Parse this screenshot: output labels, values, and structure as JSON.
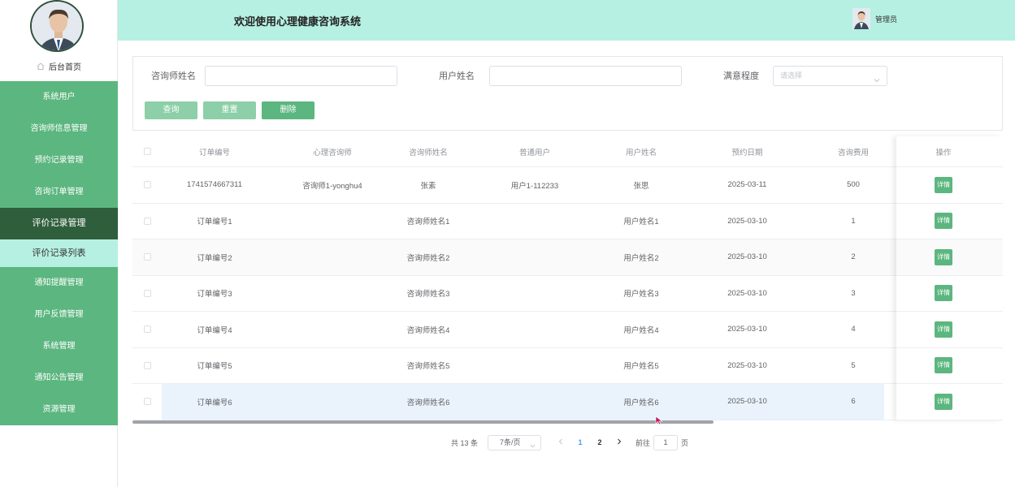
{
  "header": {
    "title": "欢迎使用心理健康咨询系统",
    "user": "管理员",
    "bg_color": "#b6f0e2"
  },
  "sidebar": {
    "home": "后台首页",
    "items": [
      {
        "label": "系统用户"
      },
      {
        "label": "咨询师信息管理"
      },
      {
        "label": "预约记录管理"
      },
      {
        "label": "咨询订单管理"
      },
      {
        "label": "评价记录管理"
      },
      {
        "label": "评价记录列表"
      },
      {
        "label": "通知提醒管理"
      },
      {
        "label": "用户反馈管理"
      },
      {
        "label": "系统管理"
      },
      {
        "label": "通知公告管理"
      },
      {
        "label": "资源管理"
      }
    ],
    "colors": {
      "item": "#5cb67f",
      "active": "#2e5e3b",
      "sub": "#b6f0e2"
    }
  },
  "search": {
    "consultant_label": "咨询师姓名",
    "consultant_value": "",
    "user_label": "用户姓名",
    "user_value": "",
    "satisfaction_label": "满意程度",
    "satisfaction_placeholder": "请选择",
    "query_btn": "查询",
    "reset_btn": "重置",
    "delete_btn": "删除"
  },
  "table": {
    "headers": [
      "订单编号",
      "心理咨询师",
      "咨询师姓名",
      "普通用户",
      "用户姓名",
      "预约日期",
      "咨询费用",
      "操作"
    ],
    "rows": [
      {
        "no": "1741574667311",
        "consultant": "咨询师1-yonghu4",
        "cname": "张素",
        "user": "用户1-112233",
        "uname": "张思",
        "date": "2025-03-11",
        "fee": "500",
        "op": "详情"
      },
      {
        "no": "订单编号1",
        "consultant": "",
        "cname": "咨询师姓名1",
        "user": "",
        "uname": "用户姓名1",
        "date": "2025-03-10",
        "fee": "1",
        "op": "详情"
      },
      {
        "no": "订单编号2",
        "consultant": "",
        "cname": "咨询师姓名2",
        "user": "",
        "uname": "用户姓名2",
        "date": "2025-03-10",
        "fee": "2",
        "op": "详情"
      },
      {
        "no": "订单编号3",
        "consultant": "",
        "cname": "咨询师姓名3",
        "user": "",
        "uname": "用户姓名3",
        "date": "2025-03-10",
        "fee": "3",
        "op": "详情"
      },
      {
        "no": "订单编号4",
        "consultant": "",
        "cname": "咨询师姓名4",
        "user": "",
        "uname": "用户姓名4",
        "date": "2025-03-10",
        "fee": "4",
        "op": "详情"
      },
      {
        "no": "订单编号5",
        "consultant": "",
        "cname": "咨询师姓名5",
        "user": "",
        "uname": "用户姓名5",
        "date": "2025-03-10",
        "fee": "5",
        "op": "详情"
      },
      {
        "no": "订单编号6",
        "consultant": "",
        "cname": "咨询师姓名6",
        "user": "",
        "uname": "用户姓名6",
        "date": "2025-03-10",
        "fee": "6",
        "op": "详情"
      }
    ]
  },
  "pagination": {
    "total": "共 13 条",
    "page_size": "7条/页",
    "pages": [
      "1",
      "2"
    ],
    "current": "1",
    "goto_label": "前往",
    "goto_value": "1",
    "page_unit": "页"
  }
}
